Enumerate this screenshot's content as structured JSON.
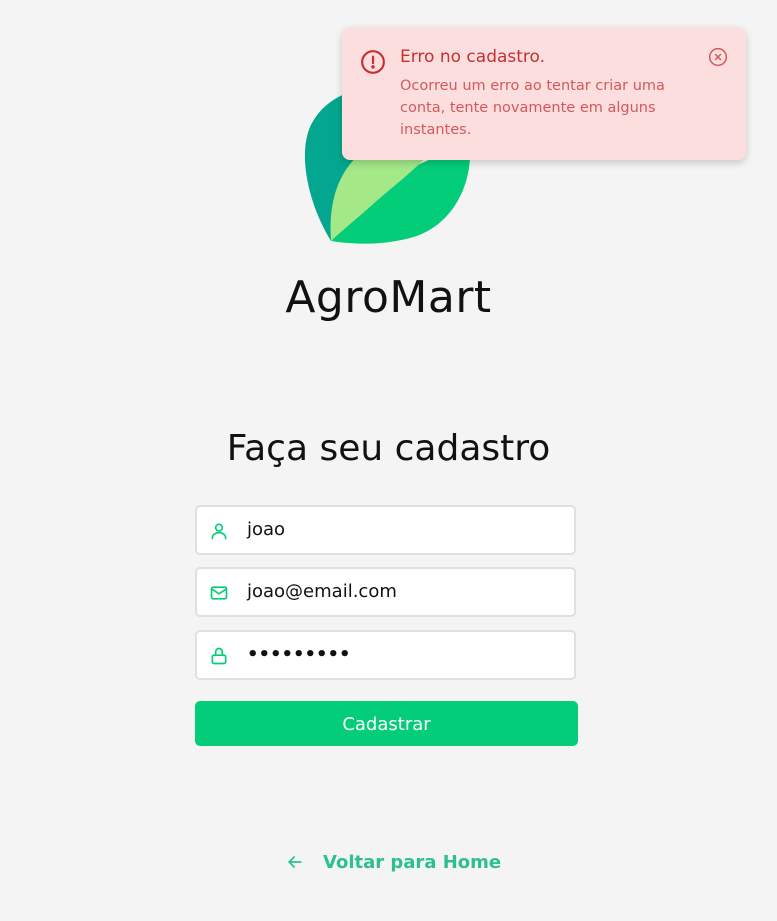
{
  "brand": {
    "name": "AgroMart"
  },
  "page": {
    "title": "Faça seu cadastro"
  },
  "form": {
    "name_value": "joao",
    "email_value": "joao@email.com",
    "password_value": "•••••••••",
    "submit_label": "Cadastrar"
  },
  "nav": {
    "back_label": "Voltar para Home"
  },
  "toast": {
    "title": "Erro no cadastro.",
    "message": "Ocorreu um erro ao tentar criar uma conta, tente novamente em alguns instantes."
  },
  "icons": {
    "name_field": "user-icon",
    "email_field": "mail-icon",
    "password_field": "lock-icon",
    "back": "arrow-left-icon",
    "toast_alert": "alert-circle-icon",
    "toast_close": "x-circle-icon"
  },
  "colors": {
    "background": "#f4f4f4",
    "primary": "#04cd79",
    "link": "#2fbf8f",
    "toast_bg": "#fddede",
    "toast_title": "#c53030",
    "toast_text": "#d4585a"
  }
}
